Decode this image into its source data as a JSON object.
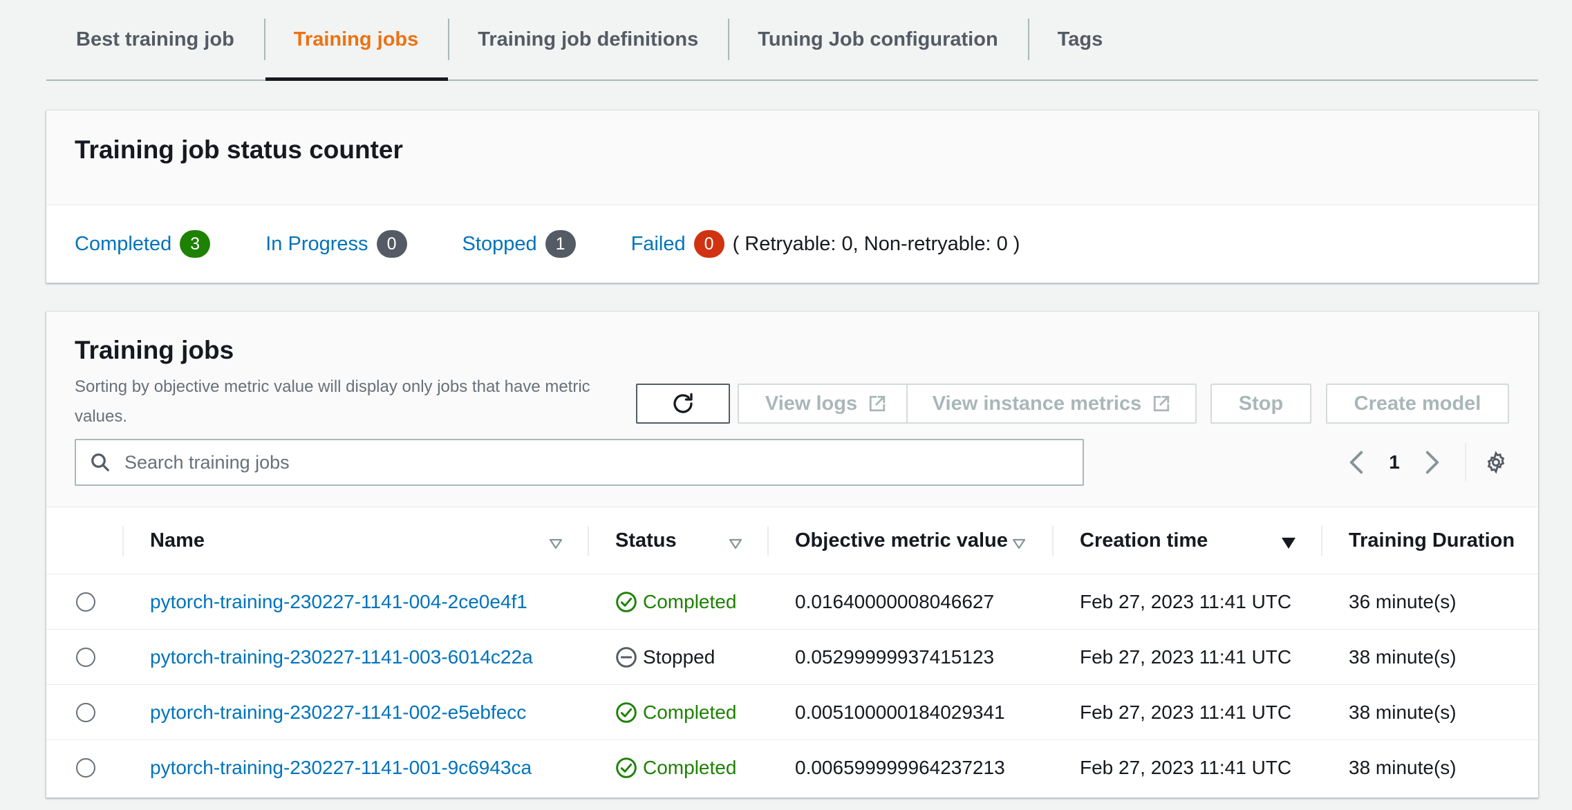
{
  "tabs": [
    {
      "label": "Best training job",
      "active": false
    },
    {
      "label": "Training jobs",
      "active": true
    },
    {
      "label": "Training job definitions",
      "active": false
    },
    {
      "label": "Tuning Job configuration",
      "active": false
    },
    {
      "label": "Tags",
      "active": false
    }
  ],
  "status_counter": {
    "title": "Training job status counter",
    "completed": {
      "label": "Completed",
      "count": "3"
    },
    "in_progress": {
      "label": "In Progress",
      "count": "0"
    },
    "stopped": {
      "label": "Stopped",
      "count": "1"
    },
    "failed": {
      "label": "Failed",
      "count": "0",
      "note": "( Retryable: 0, Non-retryable: 0 )"
    }
  },
  "training_jobs": {
    "title": "Training jobs",
    "description": "Sorting by objective metric value will display only jobs that have metric values.",
    "buttons": {
      "view_logs": "View logs",
      "view_instance_metrics": "View instance metrics",
      "stop": "Stop",
      "create_model": "Create model"
    },
    "search": {
      "placeholder": "Search training jobs",
      "value": ""
    },
    "pagination": {
      "current_page": "1"
    },
    "columns": {
      "name": "Name",
      "status": "Status",
      "metric": "Objective metric value",
      "creation_time": "Creation time",
      "duration": "Training Duration"
    },
    "rows": [
      {
        "name": "pytorch-training-230227-1141-004-2ce0e4f1",
        "status": "Completed",
        "metric": "0.01640000008046627",
        "creation_time": "Feb 27, 2023 11:41 UTC",
        "duration": "36 minute(s)"
      },
      {
        "name": "pytorch-training-230227-1141-003-6014c22a",
        "status": "Stopped",
        "metric": "0.05299999937415123",
        "creation_time": "Feb 27, 2023 11:41 UTC",
        "duration": "38 minute(s)"
      },
      {
        "name": "pytorch-training-230227-1141-002-e5ebfecc",
        "status": "Completed",
        "metric": "0.005100000184029341",
        "creation_time": "Feb 27, 2023 11:41 UTC",
        "duration": "38 minute(s)"
      },
      {
        "name": "pytorch-training-230227-1141-001-9c6943ca",
        "status": "Completed",
        "metric": "0.006599999964237213",
        "creation_time": "Feb 27, 2023 11:41 UTC",
        "duration": "38 minute(s)"
      }
    ]
  },
  "colors": {
    "accent_orange": "#ec7211",
    "link_blue": "#0073bb",
    "success_green": "#1d8102",
    "error_red": "#d13212",
    "neutral_gray": "#545b64"
  },
  "icons": {
    "refresh": "refresh-icon",
    "external": "external-link-icon",
    "search": "search-icon",
    "prev": "chevron-left-icon",
    "next": "chevron-right-icon",
    "settings": "gear-icon",
    "sort": "sort-caret-icon",
    "completed": "check-circle-icon",
    "stopped": "minus-circle-icon"
  }
}
